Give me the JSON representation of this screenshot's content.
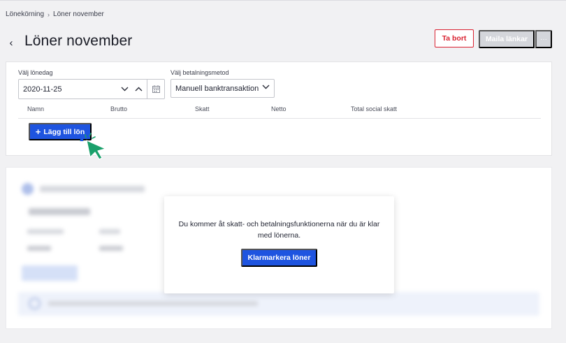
{
  "breadcrumb": {
    "parent": "Lönekörning",
    "current": "Löner november"
  },
  "header": {
    "title": "Löner november",
    "delete_label": "Ta bort",
    "mail_label": "Maila länkar",
    "more_label": "···"
  },
  "form": {
    "payday_label": "Välj lönedag",
    "payday_value": "2020-11-25",
    "payment_method_label": "Välj betalningsmetod",
    "payment_method_value": "Manuell banktransaktion"
  },
  "table": {
    "columns": [
      "Namn",
      "Brutto",
      "Skatt",
      "Netto",
      "Total social skatt"
    ]
  },
  "add_salary_label": "Lägg till lön",
  "modal": {
    "message": "Du kommer åt skatt- och betalningsfunktionerna när du är klar med lönerna.",
    "button_label": "Klarmarkera löner"
  },
  "colors": {
    "primary": "#1e54e0",
    "danger": "#d9202f",
    "disabled": "#d4d6db",
    "cursor": "#1aa06b"
  },
  "icons": {
    "back": "chevron-left-icon",
    "date_down": "chevron-down-icon",
    "date_up": "chevron-up-icon",
    "calendar": "calendar-icon",
    "select": "chevron-down-icon",
    "add": "plus-icon",
    "cursor": "pointer-cursor-icon"
  }
}
